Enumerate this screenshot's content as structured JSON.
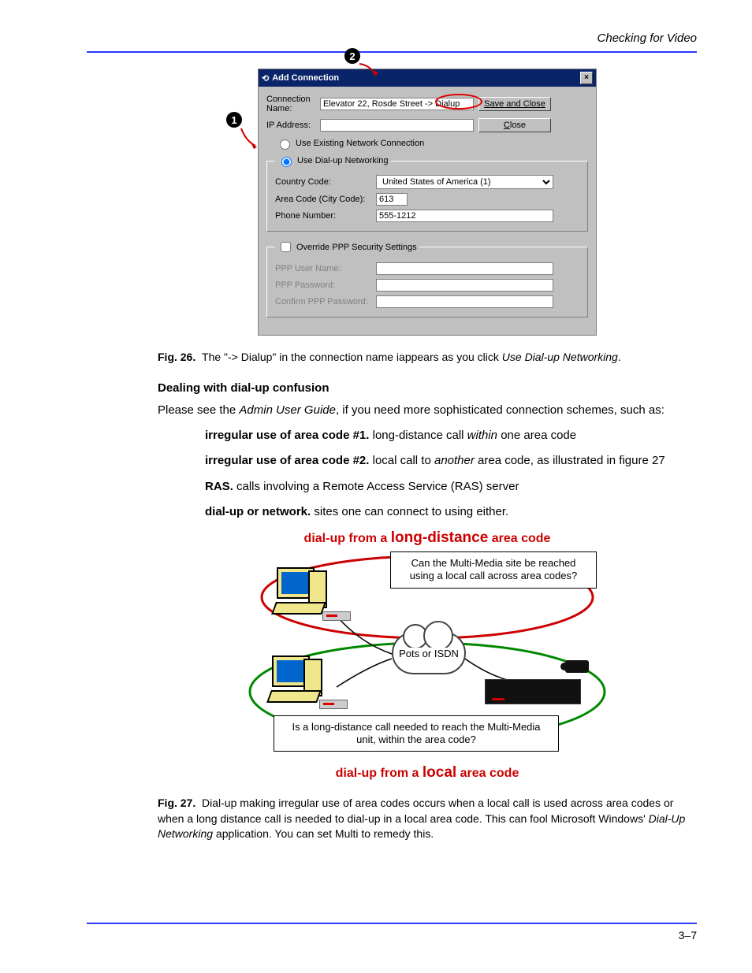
{
  "header": "Checking for Video",
  "dialog": {
    "title": "Add Connection",
    "conn_name_label": "Connection Name:",
    "conn_name_value": "Elevator 22, Rosde Street -> Dialup",
    "ip_label": "IP Address:",
    "ip_value": "",
    "btn_save": "Save and Close",
    "btn_close": "Close",
    "radio_existing": "Use Existing Network Connection",
    "radio_dialup": "Use Dial-up Networking",
    "country_label": "Country Code:",
    "country_value": "United States of America (1)",
    "area_label": "Area Code (City Code):",
    "area_value": "613",
    "phone_label": "Phone Number:",
    "phone_value": "555-1212",
    "override_label": "Override PPP Security Settings",
    "ppp_user_label": "PPP User Name:",
    "ppp_pass_label": "PPP Password:",
    "ppp_conf_label": "Confirm PPP Password:"
  },
  "fig26": {
    "label": "Fig. 26.",
    "text_a": "The \"-> Dialup\" in the connection name iappears as you click ",
    "text_em": "Use Dial-up Networking",
    "text_b": "."
  },
  "section_heading": "Dealing with dial-up confusion",
  "para1_a": "Please see the ",
  "para1_em": "Admin User Guide",
  "para1_b": ", if you need more sophisticated connection schemes, such as:",
  "defs": [
    {
      "term": "irregular use of area code #1.",
      "txt_a": " long-distance call ",
      "em": "within",
      "txt_b": " one area code"
    },
    {
      "term": "irregular use of area code #2.",
      "txt_a": " local call to ",
      "em": "another",
      "txt_b": " area code, as illustrated in figure 27"
    },
    {
      "term": "RAS.",
      "txt_a": " calls involving a Remote Access Service (RAS) server",
      "em": "",
      "txt_b": ""
    },
    {
      "term": "dial-up or network.",
      "txt_a": " sites one can connect to using either.",
      "em": "",
      "txt_b": ""
    }
  ],
  "fig27_diagram": {
    "top_curve_a": "dial-up from a ",
    "top_curve_b": "long-distance",
    "top_curve_c": " area code",
    "speech1": "Can the Multi-Media site be reached using a local call across area codes?",
    "cloud": "Pots or ISDN",
    "speech2": "Is a long-distance call needed to reach the Multi-Media unit, within the area code?",
    "bot_curve_a": "dial-up from a ",
    "bot_curve_b": "local",
    "bot_curve_c": " area code"
  },
  "fig27": {
    "label": "Fig. 27.",
    "text_a": "Dial-up making irregular use of area codes occurs when a local call is used across area codes or when a long distance call is needed to dial-up in a local area code. This can fool Microsoft Windows' ",
    "text_em": "Dial-Up Networking",
    "text_b": " application. You can set Multi to remedy this."
  },
  "page_number": "3–7"
}
